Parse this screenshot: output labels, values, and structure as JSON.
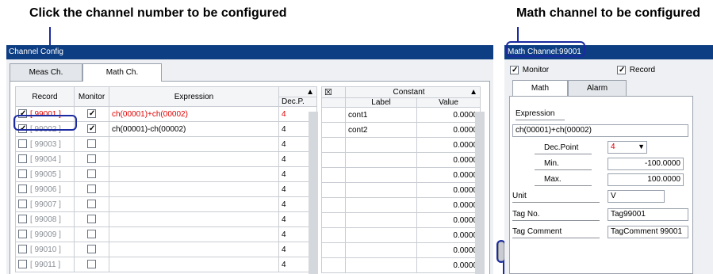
{
  "captions": {
    "left": "Click the channel number to be configured",
    "right": "Math channel to be configured"
  },
  "left_panel": {
    "title": "Channel Config",
    "tabs": [
      "Meas Ch.",
      "Math Ch."
    ],
    "active_tab": "Math Ch.",
    "columns": {
      "record": "Record",
      "monitor": "Monitor",
      "expression": "Expression",
      "dec": "Dec.P."
    },
    "sort_icon": "up-triangle-icon",
    "rows": [
      {
        "record_checked": true,
        "label": "[ 99001 ]",
        "monitor_checked": true,
        "expression": "ch(00001)+ch(00002)",
        "dec": "4",
        "highlight": true
      },
      {
        "record_checked": true,
        "label": "[ 99002 ]",
        "monitor_checked": true,
        "expression": "ch(00001)-ch(00002)",
        "dec": "4",
        "highlight": false
      },
      {
        "record_checked": false,
        "label": "[ 99003 ]",
        "monitor_checked": false,
        "expression": "",
        "dec": "4",
        "highlight": false
      },
      {
        "record_checked": false,
        "label": "[ 99004 ]",
        "monitor_checked": false,
        "expression": "",
        "dec": "4",
        "highlight": false
      },
      {
        "record_checked": false,
        "label": "[ 99005 ]",
        "monitor_checked": false,
        "expression": "",
        "dec": "4",
        "highlight": false
      },
      {
        "record_checked": false,
        "label": "[ 99006 ]",
        "monitor_checked": false,
        "expression": "",
        "dec": "4",
        "highlight": false
      },
      {
        "record_checked": false,
        "label": "[ 99007 ]",
        "monitor_checked": false,
        "expression": "",
        "dec": "4",
        "highlight": false
      },
      {
        "record_checked": false,
        "label": "[ 99008 ]",
        "monitor_checked": false,
        "expression": "",
        "dec": "4",
        "highlight": false
      },
      {
        "record_checked": false,
        "label": "[ 99009 ]",
        "monitor_checked": false,
        "expression": "",
        "dec": "4",
        "highlight": false
      },
      {
        "record_checked": false,
        "label": "[ 99010 ]",
        "monitor_checked": false,
        "expression": "",
        "dec": "4",
        "highlight": false
      },
      {
        "record_checked": false,
        "label": "[ 99011 ]",
        "monitor_checked": false,
        "expression": "",
        "dec": "4",
        "highlight": false
      }
    ],
    "constant_table": {
      "title": "Constant",
      "columns": {
        "label": "Label",
        "value": "Value"
      },
      "rows": [
        {
          "label": "cont1",
          "value": "0.0000"
        },
        {
          "label": "cont2",
          "value": "0.0000"
        },
        {
          "label": "",
          "value": "0.0000"
        },
        {
          "label": "",
          "value": "0.0000"
        },
        {
          "label": "",
          "value": "0.0000"
        },
        {
          "label": "",
          "value": "0.0000"
        },
        {
          "label": "",
          "value": "0.0000"
        },
        {
          "label": "",
          "value": "0.0000"
        },
        {
          "label": "",
          "value": "0.0000"
        },
        {
          "label": "",
          "value": "0.0000"
        },
        {
          "label": "",
          "value": "0.0000"
        }
      ]
    }
  },
  "right_panel": {
    "title": "Math Channel:99001",
    "monitor": {
      "label": "Monitor",
      "checked": true
    },
    "record": {
      "label": "Record",
      "checked": true
    },
    "tabs": [
      "Math",
      "Alarm"
    ],
    "active_tab": "Math",
    "expression_label": "Expression",
    "expression_value": "ch(00001)+ch(00002)",
    "dec_point_label": "Dec.Point",
    "dec_point_value": "4",
    "min_label": "Min.",
    "min_value": "-100.0000",
    "max_label": "Max.",
    "max_value": "100.0000",
    "unit_label": "Unit",
    "unit_value": "V",
    "tag_no_label": "Tag No.",
    "tag_no_value": "Tag99001",
    "tag_comment_label": "Tag Comment",
    "tag_comment_value": "TagComment 99001"
  },
  "colors": {
    "titlebar": "#0d3d82",
    "callout": "#1a2aa0",
    "highlight_text": "#e00000"
  }
}
